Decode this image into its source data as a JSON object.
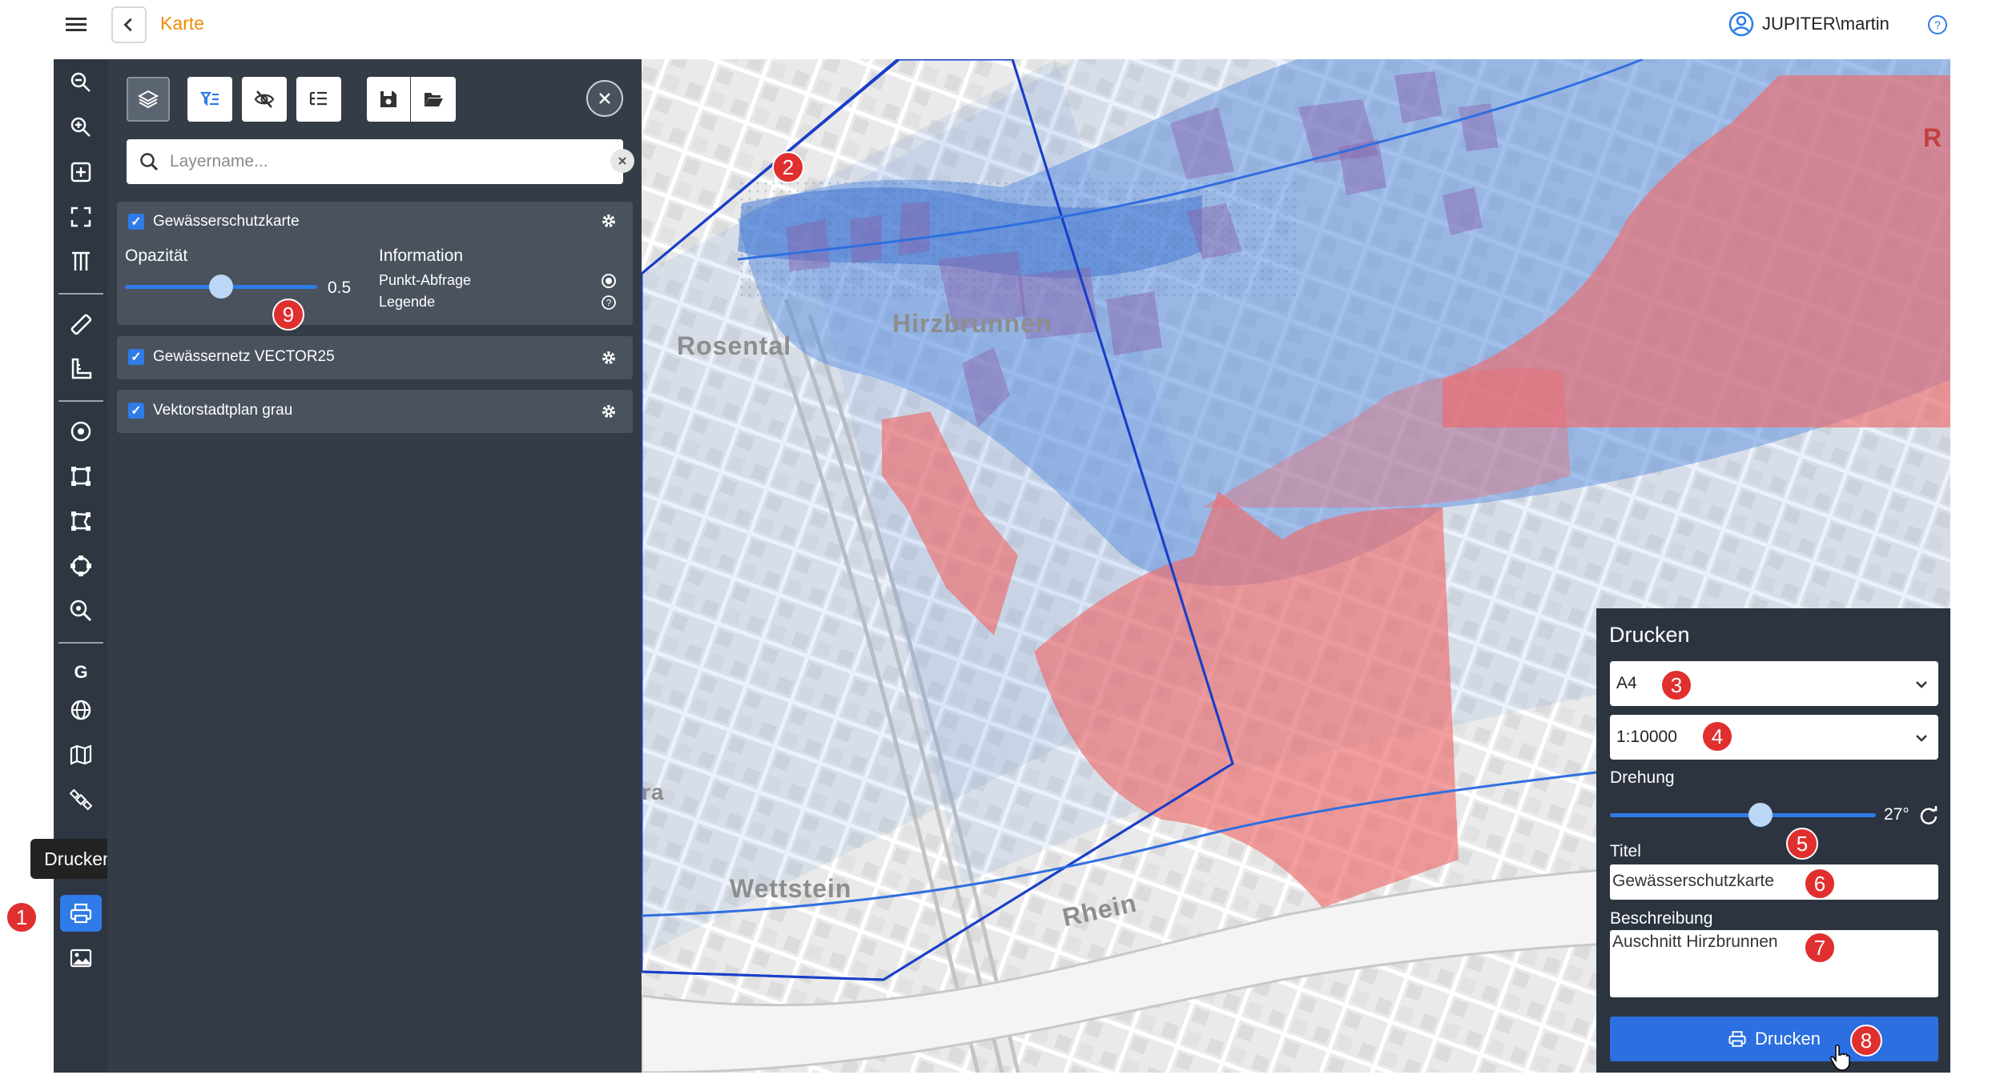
{
  "header": {
    "page_title": "Karte",
    "user_name": "JUPITER\\martin"
  },
  "toolbar": {
    "tooltip": "Drucken"
  },
  "layer_panel": {
    "search_placeholder": "Layername...",
    "layers": [
      {
        "name": "Gewässerschutzkarte",
        "checked": true,
        "expanded": true
      },
      {
        "name": "Gewässernetz VECTOR25",
        "checked": true
      },
      {
        "name": "Vektorstadtplan grau",
        "checked": true
      }
    ],
    "opacity_label": "Opazität",
    "opacity_value": "0.5",
    "opacity_fraction": 0.5,
    "info_label": "Information",
    "info_point_query": "Punkt-Abfrage",
    "info_legend": "Legende"
  },
  "map": {
    "labels": [
      "Hirzbrunnen",
      "Rosental",
      "Wettstein",
      "Rhein",
      "ra",
      "R"
    ]
  },
  "print": {
    "title": "Drucken",
    "format": "A4",
    "scale": "1:10000",
    "rotation_label": "Drehung",
    "rotation_value": "27°",
    "rotation_degrees": 27,
    "title_label": "Titel",
    "title_value": "Gewässerschutzkarte",
    "description_label": "Beschreibung",
    "description_value": "Auschnitt Hirzbrunnen",
    "button_label": "Drucken"
  },
  "badges": [
    "1",
    "2",
    "3",
    "4",
    "5",
    "6",
    "7",
    "8",
    "9"
  ],
  "colors": {
    "accent": "#2f7be8",
    "title_orange": "#f08c00",
    "badge_red": "#e02f2f",
    "panel_dark": "#343c48",
    "toolbar_dark": "#2e3642",
    "zone_blue": "#5b8fe0",
    "zone_red": "#ee6b6b"
  }
}
